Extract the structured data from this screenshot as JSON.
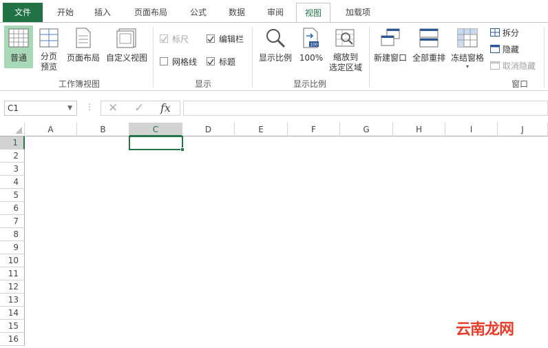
{
  "tabs": [
    "文件",
    "开始",
    "插入",
    "页面布局",
    "公式",
    "数据",
    "审阅",
    "视图",
    "加载项"
  ],
  "ribbon": {
    "workbook_views": {
      "normal": "普通",
      "page_break": "分页",
      "page_break2": "预览",
      "page_layout": "页面布局",
      "custom": "自定义视图",
      "group": "工作簿视图"
    },
    "show": {
      "ruler": "标尺",
      "formula_bar": "编辑栏",
      "gridlines": "网格线",
      "headings": "标题",
      "group": "显示"
    },
    "zoom": {
      "zoom": "显示比例",
      "hundred": "100%",
      "zoom_sel": "缩放到",
      "zoom_sel2": "选定区域",
      "group": "显示比例",
      "badge": "100"
    },
    "window": {
      "new_window": "新建窗口",
      "arrange_all": "全部重排",
      "freeze": "冻结窗格",
      "split": "拆分",
      "hide": "隐藏",
      "unhide": "取消隐藏",
      "group": "窗口"
    }
  },
  "formula_bar": {
    "name_box": "C1",
    "cancel": "✕",
    "enter": "✓",
    "fx": "fx",
    "sep": "⋮",
    "value": ""
  },
  "columns": [
    "A",
    "B",
    "C",
    "D",
    "E",
    "F",
    "G",
    "H",
    "I",
    "J"
  ],
  "rows": [
    "1",
    "2",
    "3",
    "4",
    "5",
    "6",
    "7",
    "8",
    "9",
    "10",
    "11",
    "12",
    "13",
    "14",
    "15",
    "16"
  ],
  "active_cell": "C1",
  "watermark": "云南龙网",
  "colors": {
    "accent": "#217346",
    "watermark": "#e63c28"
  }
}
